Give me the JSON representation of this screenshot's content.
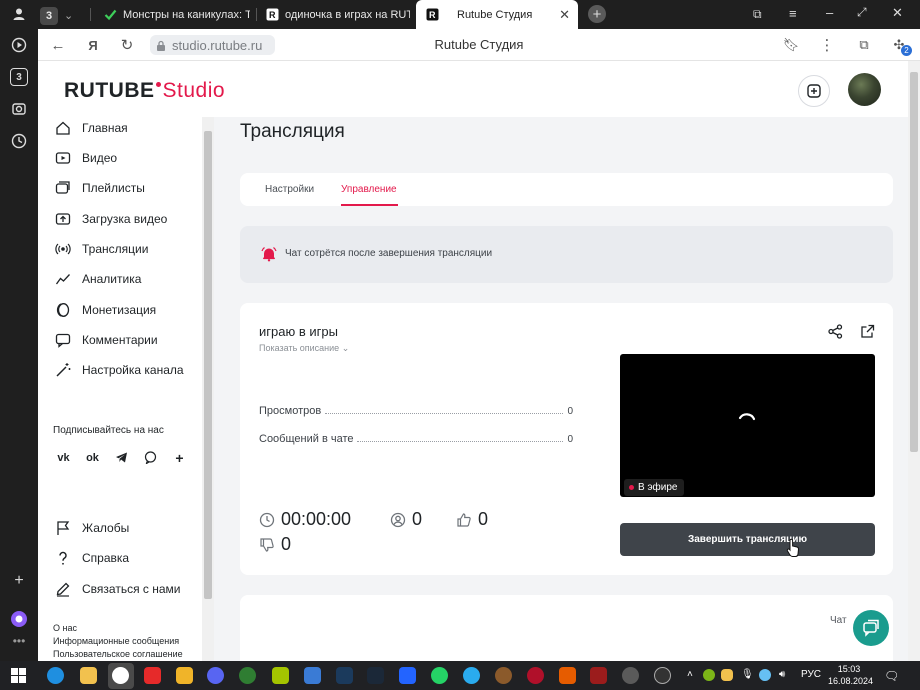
{
  "browser": {
    "tabs": [
      {
        "label": "3"
      },
      {
        "label": "Монстры на каникулах: Тр"
      },
      {
        "label": "одиночка в играх на RUT"
      },
      {
        "label": "Rutube Студия",
        "active": true
      }
    ],
    "url": "studio.rutube.ru",
    "page_title": "Rutube Студия",
    "sidebar_badge": "3",
    "ext_badge": "2"
  },
  "header": {
    "logo_main": "RUTUBE",
    "logo_studio": "Studio"
  },
  "nav": {
    "items": [
      {
        "label": "Главная",
        "icon": "home-icon"
      },
      {
        "label": "Видео",
        "icon": "video-icon"
      },
      {
        "label": "Плейлисты",
        "icon": "playlist-icon"
      },
      {
        "label": "Загрузка видео",
        "icon": "upload-icon"
      },
      {
        "label": "Трансляции",
        "icon": "broadcast-icon"
      },
      {
        "label": "Аналитика",
        "icon": "analytics-icon"
      },
      {
        "label": "Монетизация",
        "icon": "coin-icon"
      },
      {
        "label": "Комментарии",
        "icon": "comment-icon"
      },
      {
        "label": "Настройка канала",
        "icon": "wand-icon"
      }
    ],
    "follow_label": "Подписывайтесь на нас",
    "socials": [
      "vk",
      "ok",
      "telegram",
      "viber",
      "+"
    ],
    "bottom_items": [
      {
        "label": "Жалобы",
        "icon": "flag-icon"
      },
      {
        "label": "Справка",
        "icon": "help-icon"
      },
      {
        "label": "Связаться с нами",
        "icon": "pen-icon"
      }
    ],
    "footer_links": [
      "О нас",
      "Информационные сообщения",
      "Пользовательское соглашение"
    ]
  },
  "main": {
    "title": "Трансляция",
    "tabs": [
      {
        "label": "Настройки"
      },
      {
        "label": "Управление",
        "active": true
      }
    ],
    "notice": "Чат сотрётся после завершения трансляции",
    "stream": {
      "title": "играю в игры",
      "show_description": "Показать описание",
      "stats": [
        {
          "label": "Просмотров",
          "value": "0"
        },
        {
          "label": "Сообщений в чате",
          "value": "0"
        }
      ],
      "duration": "00:00:00",
      "viewers": "0",
      "likes": "0",
      "dislikes": "0",
      "live_label": "В эфире",
      "end_button": "Завершить трансляцию"
    },
    "chat_label": "Чат"
  },
  "taskbar": {
    "lang": "РУС",
    "time": "15:03",
    "date": "16.08.2024"
  },
  "colors": {
    "accent": "#e3194b",
    "dark_button": "#3f444a",
    "support": "#1a9c8e"
  }
}
